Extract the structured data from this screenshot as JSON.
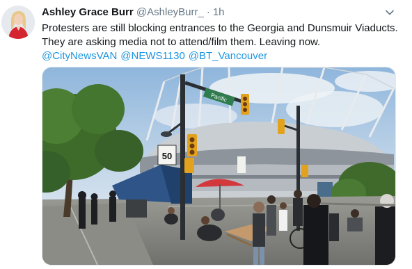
{
  "tweet": {
    "author": {
      "display_name": "Ashley Grace Burr",
      "handle": "@AshleyBurr_",
      "separator": "·",
      "time": "1h"
    },
    "text_lines": [
      "Protesters are still blocking entrances to the Georgia and Dunsmuir Viaducts.",
      "They are asking media not to attend/film them. Leaving now."
    ],
    "mentions": [
      "@CityNewsVAN",
      "@NEWS1130",
      "@BT_Vancouver"
    ],
    "icons": {
      "avatar": "profile-photo",
      "more": "chevron-down-icon"
    },
    "media": {
      "kind": "photo",
      "signs": {
        "speed": "50",
        "street": "Pacific"
      }
    },
    "colors": {
      "link": "#1b95e0",
      "secondary": "#657786",
      "text": "#14171a"
    }
  }
}
